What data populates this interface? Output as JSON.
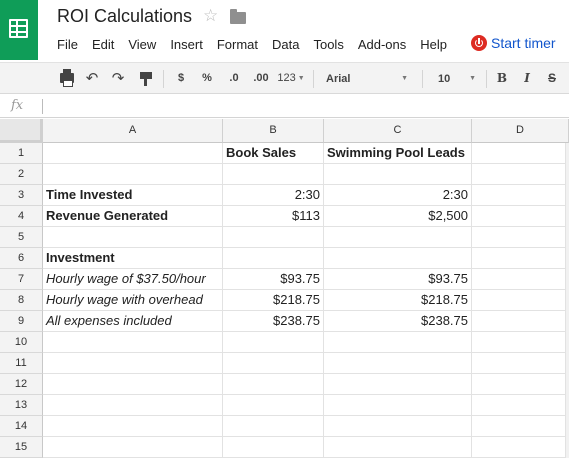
{
  "document": {
    "title": "ROI Calculations",
    "star_icon": "star-outline-icon",
    "folder_icon": "folder-icon"
  },
  "menu": [
    {
      "label": "File"
    },
    {
      "label": "Edit"
    },
    {
      "label": "View"
    },
    {
      "label": "Insert"
    },
    {
      "label": "Format"
    },
    {
      "label": "Data"
    },
    {
      "label": "Tools"
    },
    {
      "label": "Add-ons"
    },
    {
      "label": "Help"
    }
  ],
  "timer": {
    "label": "Start timer",
    "icon": "power-icon",
    "color": "#dd2b22",
    "link_color": "#1155cc"
  },
  "toolbar": {
    "currency_label": "$",
    "percent_label": "%",
    "decrease_decimals_label": ".0",
    "increase_decimals_label": ".00",
    "more_formats_label": "123",
    "font_family": "Arial",
    "font_size": "10",
    "bold_label": "B",
    "italic_label": "I",
    "strikethrough_label": "S"
  },
  "formula_bar": {
    "icon": "fx-icon",
    "label": "fx",
    "value": ""
  },
  "brand": {
    "accent": "#0f9d58"
  },
  "columns": [
    "A",
    "B",
    "C",
    "D"
  ],
  "rows": [
    {
      "num": "1",
      "a": "",
      "b": "Book Sales",
      "c": "Swimming Pool Leads"
    },
    {
      "num": "2",
      "a": "",
      "b": "",
      "c": ""
    },
    {
      "num": "3",
      "a": "Time Invested",
      "b": "2:30",
      "c": "2:30"
    },
    {
      "num": "4",
      "a": "Revenue Generated",
      "b": "$113",
      "c": "$2,500"
    },
    {
      "num": "5",
      "a": "",
      "b": "",
      "c": ""
    },
    {
      "num": "6",
      "a": "Investment",
      "b": "",
      "c": ""
    },
    {
      "num": "7",
      "a": "Hourly wage of $37.50/hour",
      "b": "$93.75",
      "c": "$93.75"
    },
    {
      "num": "8",
      "a": "Hourly wage with overhead",
      "b": "$218.75",
      "c": "$218.75"
    },
    {
      "num": "9",
      "a": "All expenses included",
      "b": "$238.75",
      "c": "$238.75"
    },
    {
      "num": "10",
      "a": "",
      "b": "",
      "c": ""
    },
    {
      "num": "11",
      "a": "",
      "b": "",
      "c": ""
    },
    {
      "num": "12",
      "a": "",
      "b": "",
      "c": ""
    },
    {
      "num": "13",
      "a": "",
      "b": "",
      "c": ""
    },
    {
      "num": "14",
      "a": "",
      "b": "",
      "c": ""
    },
    {
      "num": "15",
      "a": "",
      "b": "",
      "c": ""
    }
  ]
}
